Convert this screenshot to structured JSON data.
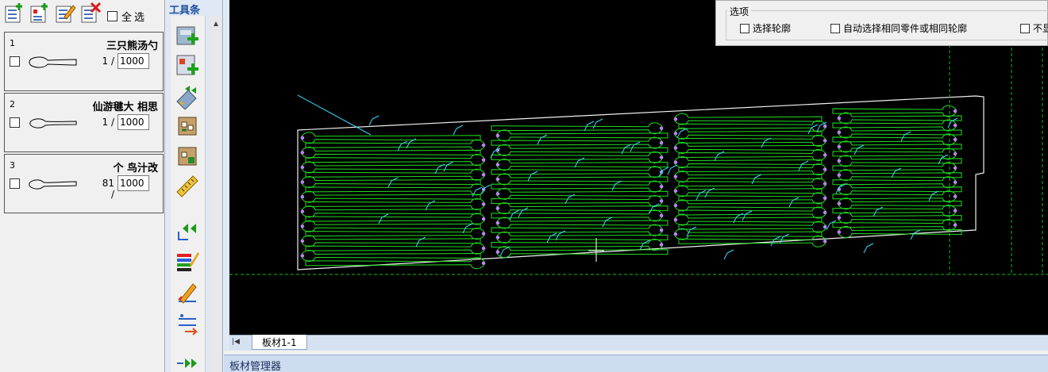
{
  "top_tools": [
    {
      "name": "add-part-icon"
    },
    {
      "name": "import-part-icon"
    },
    {
      "name": "edit-part-icon"
    },
    {
      "name": "delete-part-icon"
    }
  ],
  "select_all_label": "全选",
  "parts": [
    {
      "index": "1",
      "name": "三只熊汤勺",
      "count": "1 /",
      "total": "1000"
    },
    {
      "index": "2",
      "name": "仙游毽大 相思",
      "count": "1 /",
      "total": "1000"
    },
    {
      "index": "3",
      "name": "个 鸟汁改",
      "count": "81 /",
      "total": "1000"
    }
  ],
  "toolbar": {
    "title": "工具条",
    "buttons": [
      "add-sheet-icon",
      "import-sheet-icon",
      "auto-nest-icon",
      "remnant-icon",
      "remnant-edit-icon",
      "measure-ruler-icon",
      "rewind-icon",
      "layer-color-icon",
      "edit-path-icon",
      "sort-icon",
      "fast-forward-icon"
    ]
  },
  "options": {
    "title": "选项",
    "items": [
      "选择轮廓",
      "自动选择相同零件或相同轮廓",
      "不显"
    ]
  },
  "sheet_tab": "板材1-1",
  "bottom_label": "板材管理器",
  "colors": {
    "canvas_bg": "#000000",
    "part_green": "#20dd20",
    "dashed_green": "#18b818",
    "sheet_outline": "#f0f0f0",
    "lead_cyan": "#33d8ff",
    "pierce_purple": "#c080ff"
  }
}
